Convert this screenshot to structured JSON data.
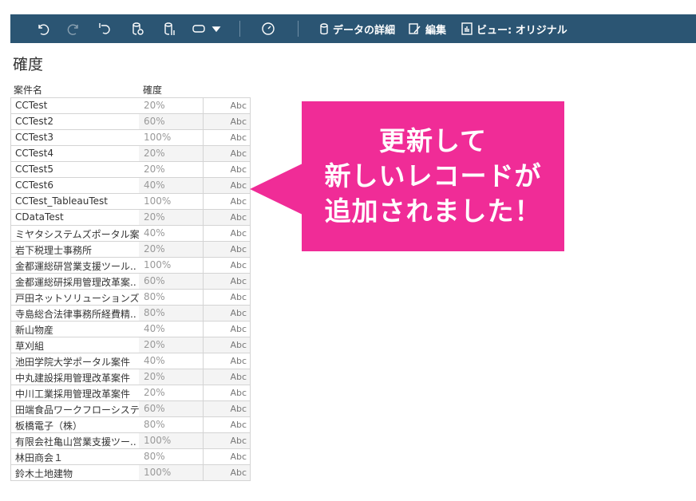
{
  "toolbar": {
    "data_detail": "データの詳細",
    "edit": "編集",
    "view": "ビュー: オリジナル"
  },
  "title": "確度",
  "headers": {
    "name": "案件名",
    "prob": "確度"
  },
  "rows": [
    [
      "CCTest",
      "20%",
      "Abc"
    ],
    [
      "CCTest2",
      "60%",
      "Abc"
    ],
    [
      "CCTest3",
      "100%",
      "Abc"
    ],
    [
      "CCTest4",
      "20%",
      "Abc"
    ],
    [
      "CCTest5",
      "20%",
      "Abc"
    ],
    [
      "CCTest6",
      "40%",
      "Abc"
    ],
    [
      "CCTest_TableauTest",
      "100%",
      "Abc"
    ],
    [
      "CDataTest",
      "20%",
      "Abc"
    ],
    [
      "ミヤタシステムズポータル案",
      "40%",
      "Abc"
    ],
    [
      "岩下税理士事務所",
      "20%",
      "Abc"
    ],
    [
      "金都運総研営業支援ツール..",
      "100%",
      "Abc"
    ],
    [
      "金都運総研採用管理改革案..",
      "60%",
      "Abc"
    ],
    [
      "戸田ネットソリューションズ",
      "80%",
      "Abc"
    ],
    [
      "寺島総合法律事務所経費精..",
      "80%",
      "Abc"
    ],
    [
      "新山物産",
      "40%",
      "Abc"
    ],
    [
      "草刈組",
      "20%",
      "Abc"
    ],
    [
      "池田学院大学ポータル案件",
      "40%",
      "Abc"
    ],
    [
      "中丸建設採用管理改革案件",
      "20%",
      "Abc"
    ],
    [
      "中川工業採用管理改革案件",
      "20%",
      "Abc"
    ],
    [
      "田端食品ワークフローシステ",
      "60%",
      "Abc"
    ],
    [
      "板橋電子（株）",
      "80%",
      "Abc"
    ],
    [
      "有限会社亀山営業支援ツー..",
      "100%",
      "Abc"
    ],
    [
      "林田商会１",
      "80%",
      "Abc"
    ],
    [
      "鈴木土地建物",
      "100%",
      "Abc"
    ]
  ],
  "callout": [
    "更新して",
    "新しいレコードが",
    "追加されました！"
  ],
  "colors": {
    "toolbar": "#2b5573",
    "callout": "#f02c97"
  }
}
